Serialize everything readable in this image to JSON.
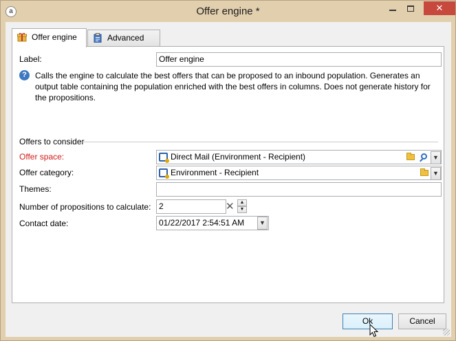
{
  "window": {
    "title": "Offer engine *",
    "app_icon": "adobe-campaign-icon",
    "minimize_icon": "minimize-icon",
    "maximize_icon": "maximize-icon",
    "close_glyph": "✕"
  },
  "tabs": [
    {
      "label": "Offer engine",
      "icon": "gift-icon",
      "active": true
    },
    {
      "label": "Advanced",
      "icon": "clipboard-icon",
      "active": false
    }
  ],
  "form": {
    "label_caption": "Label:",
    "label_value": "Offer engine",
    "help_text": "Calls the engine to calculate the best offers that can be proposed to an inbound population. Generates an output table containing the population enriched with the best offers in columns. Does not generate history for the propositions.",
    "section_title": "Offers to consider",
    "offer_space_caption": "Offer space:",
    "offer_space_value": "Direct Mail (Environment - Recipient)",
    "offer_category_caption": "Offer category:",
    "offer_category_value": "Environment - Recipient",
    "themes_caption": "Themes:",
    "themes_value": "",
    "propositions_caption": "Number of propositions to calculate:",
    "propositions_value": "2",
    "contact_date_caption": "Contact date:",
    "contact_date_value": "01/22/2017 2:54:51 AM"
  },
  "buttons": {
    "ok_label": "Ok",
    "cancel_label": "Cancel"
  },
  "colors": {
    "required_label": "#d11a1a",
    "title_bar": "#e2cfae",
    "close_button": "#c7483d"
  }
}
